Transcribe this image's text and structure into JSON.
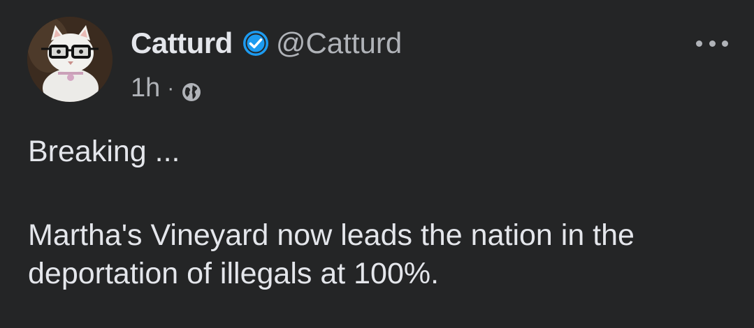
{
  "post": {
    "author": {
      "name": "Catturd",
      "handle": "@Catturd",
      "verified": true
    },
    "time": "1h",
    "separator": "·",
    "visibility_icon": "globe-icon",
    "more_icon": "more-options-icon",
    "content": {
      "paragraph_1": "Breaking ...",
      "paragraph_2": "Martha's Vineyard now leads the nation in the deportation of illegals at 100%."
    }
  },
  "colors": {
    "background": "#242526",
    "primary_text": "#e4e6eb",
    "secondary_text": "#b0b3b8",
    "verified_badge": "#1d9bf0"
  }
}
